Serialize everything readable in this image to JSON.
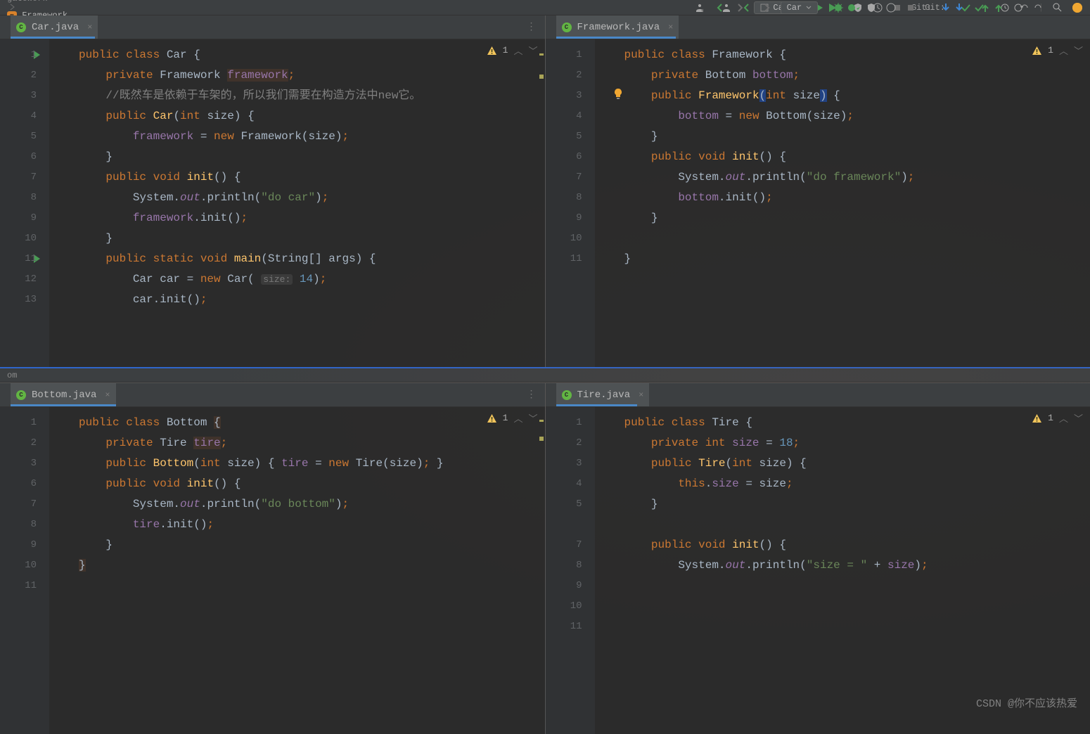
{
  "breadcrumb": {
    "seg1": "gatework",
    "seg2": "Framework"
  },
  "breadcrumb2": {
    "seg1": "om"
  },
  "runConfig": "Car",
  "gitLabel": "Git:",
  "watermark": "CSDN @你不应该热爱",
  "panes": {
    "car": {
      "tab": "Car.java",
      "warn": "1",
      "lines": [
        "1",
        "2",
        "3",
        "4",
        "5",
        "6",
        "7",
        "8",
        "9",
        "10",
        "11",
        "12",
        "13"
      ],
      "code": [
        [
          {
            "t": "public ",
            "c": "hl-kw"
          },
          {
            "t": "class ",
            "c": "hl-kw"
          },
          {
            "t": "Car {"
          }
        ],
        [
          {
            "t": "    "
          },
          {
            "t": "private ",
            "c": "hl-kw"
          },
          {
            "t": "Framework "
          },
          {
            "t": "framework",
            "c": "hl-field hl-usage"
          },
          {
            "t": ";",
            "c": "hl-kw"
          }
        ],
        [
          {
            "t": "    "
          },
          {
            "t": "//既然车是依赖于车架的，所以我们需要在构造方法中new它。",
            "c": "hl-comment"
          }
        ],
        [
          {
            "t": "    "
          },
          {
            "t": "public ",
            "c": "hl-kw"
          },
          {
            "t": "Car",
            "c": "hl-fn"
          },
          {
            "t": "("
          },
          {
            "t": "int ",
            "c": "hl-kw"
          },
          {
            "t": "size) {"
          }
        ],
        [
          {
            "t": "        "
          },
          {
            "t": "framework",
            "c": "hl-field"
          },
          {
            "t": " = "
          },
          {
            "t": "new ",
            "c": "hl-kw"
          },
          {
            "t": "Framework(size)"
          },
          {
            "t": ";",
            "c": "hl-kw"
          }
        ],
        [
          {
            "t": "    }"
          }
        ],
        [
          {
            "t": "    "
          },
          {
            "t": "public ",
            "c": "hl-kw"
          },
          {
            "t": "void ",
            "c": "hl-kw"
          },
          {
            "t": "init",
            "c": "hl-fn"
          },
          {
            "t": "() {"
          }
        ],
        [
          {
            "t": "        System."
          },
          {
            "t": "out",
            "c": "hl-static"
          },
          {
            "t": ".println("
          },
          {
            "t": "\"do car\"",
            "c": "hl-str"
          },
          {
            "t": ")"
          },
          {
            "t": ";",
            "c": "hl-kw"
          }
        ],
        [
          {
            "t": "        "
          },
          {
            "t": "framework",
            "c": "hl-field"
          },
          {
            "t": ".init()"
          },
          {
            "t": ";",
            "c": "hl-kw"
          }
        ],
        [
          {
            "t": "    }"
          }
        ],
        [
          {
            "t": "    "
          },
          {
            "t": "public ",
            "c": "hl-kw"
          },
          {
            "t": "static ",
            "c": "hl-kw"
          },
          {
            "t": "void ",
            "c": "hl-kw"
          },
          {
            "t": "main",
            "c": "hl-fn"
          },
          {
            "t": "(String[] args) {"
          }
        ],
        [
          {
            "t": "        Car car = "
          },
          {
            "t": "new ",
            "c": "hl-kw"
          },
          {
            "t": "Car( "
          },
          {
            "t": "size:",
            "c": "hl-hint"
          },
          {
            "t": " "
          },
          {
            "t": "14",
            "c": "hl-num"
          },
          {
            "t": ")"
          },
          {
            "t": ";",
            "c": "hl-kw"
          }
        ],
        [
          {
            "t": "        car.init()"
          },
          {
            "t": ";",
            "c": "hl-kw"
          }
        ]
      ]
    },
    "fw": {
      "tab": "Framework.java",
      "warn": "1",
      "lines": [
        "1",
        "2",
        "3",
        "4",
        "5",
        "6",
        "7",
        "8",
        "9",
        "10",
        "11"
      ],
      "code": [
        [
          {
            "t": "public ",
            "c": "hl-kw"
          },
          {
            "t": "class ",
            "c": "hl-kw"
          },
          {
            "t": "Framework {"
          }
        ],
        [
          {
            "t": "    "
          },
          {
            "t": "private ",
            "c": "hl-kw"
          },
          {
            "t": "Bottom "
          },
          {
            "t": "bottom",
            "c": "hl-field"
          },
          {
            "t": ";",
            "c": "hl-kw"
          }
        ],
        [
          {
            "t": "    "
          },
          {
            "t": "public ",
            "c": "hl-kw"
          },
          {
            "t": "Framework",
            "c": "hl-fn"
          },
          {
            "t": "(",
            "c": "hl-caret"
          },
          {
            "t": "int ",
            "c": "hl-kw"
          },
          {
            "t": "size"
          },
          {
            "t": ")",
            "c": "hl-caret"
          },
          {
            "t": " {"
          }
        ],
        [
          {
            "t": "        "
          },
          {
            "t": "bottom",
            "c": "hl-field"
          },
          {
            "t": " = "
          },
          {
            "t": "new ",
            "c": "hl-kw"
          },
          {
            "t": "Bottom(size)"
          },
          {
            "t": ";",
            "c": "hl-kw"
          }
        ],
        [
          {
            "t": "    }"
          }
        ],
        [
          {
            "t": "    "
          },
          {
            "t": "public ",
            "c": "hl-kw"
          },
          {
            "t": "void ",
            "c": "hl-kw"
          },
          {
            "t": "init",
            "c": "hl-fn"
          },
          {
            "t": "() {"
          }
        ],
        [
          {
            "t": "        System."
          },
          {
            "t": "out",
            "c": "hl-static"
          },
          {
            "t": ".println("
          },
          {
            "t": "\"do framework\"",
            "c": "hl-str"
          },
          {
            "t": ")"
          },
          {
            "t": ";",
            "c": "hl-kw"
          }
        ],
        [
          {
            "t": "        "
          },
          {
            "t": "bottom",
            "c": "hl-field"
          },
          {
            "t": ".init()"
          },
          {
            "t": ";",
            "c": "hl-kw"
          }
        ],
        [
          {
            "t": "    }"
          }
        ],
        [
          {
            "t": ""
          }
        ],
        [
          {
            "t": "}"
          }
        ]
      ]
    },
    "bottom": {
      "tab": "Bottom.java",
      "warn": "1",
      "lines": [
        "1",
        "2",
        "3",
        "6",
        "7",
        "8",
        "9",
        "10",
        "11"
      ],
      "code": [
        [
          {
            "t": "public ",
            "c": "hl-kw"
          },
          {
            "t": "class ",
            "c": "hl-kw"
          },
          {
            "t": "Bottom "
          },
          {
            "t": "{",
            "c": "hl-usage"
          }
        ],
        [
          {
            "t": "    "
          },
          {
            "t": "private ",
            "c": "hl-kw"
          },
          {
            "t": "Tire "
          },
          {
            "t": "tire",
            "c": "hl-field hl-usage"
          },
          {
            "t": ";",
            "c": "hl-kw"
          }
        ],
        [
          {
            "t": "    "
          },
          {
            "t": "public ",
            "c": "hl-kw"
          },
          {
            "t": "Bottom",
            "c": "hl-fn"
          },
          {
            "t": "("
          },
          {
            "t": "int ",
            "c": "hl-kw"
          },
          {
            "t": "size) { "
          },
          {
            "t": "tire",
            "c": "hl-field"
          },
          {
            "t": " = "
          },
          {
            "t": "new ",
            "c": "hl-kw"
          },
          {
            "t": "Tire(size)"
          },
          {
            "t": ";",
            "c": "hl-kw"
          },
          {
            "t": " }"
          }
        ],
        [
          {
            "t": "    "
          },
          {
            "t": "public ",
            "c": "hl-kw"
          },
          {
            "t": "void ",
            "c": "hl-kw"
          },
          {
            "t": "init",
            "c": "hl-fn"
          },
          {
            "t": "() {"
          }
        ],
        [
          {
            "t": "        System."
          },
          {
            "t": "out",
            "c": "hl-static"
          },
          {
            "t": ".println("
          },
          {
            "t": "\"do bottom\"",
            "c": "hl-str"
          },
          {
            "t": ")"
          },
          {
            "t": ";",
            "c": "hl-kw"
          }
        ],
        [
          {
            "t": "        "
          },
          {
            "t": "tire",
            "c": "hl-field"
          },
          {
            "t": ".init()"
          },
          {
            "t": ";",
            "c": "hl-kw"
          }
        ],
        [
          {
            "t": "    }"
          }
        ],
        [
          {
            "t": "}",
            "c": "hl-usage"
          }
        ],
        [
          {
            "t": ""
          }
        ]
      ]
    },
    "tire": {
      "tab": "Tire.java",
      "warn": "1",
      "lines": [
        "1",
        "2",
        "3",
        "4",
        "5",
        "",
        "7",
        "8",
        "9",
        "10",
        "11"
      ],
      "code": [
        [
          {
            "t": "public ",
            "c": "hl-kw"
          },
          {
            "t": "class ",
            "c": "hl-kw"
          },
          {
            "t": "Tire {"
          }
        ],
        [
          {
            "t": "    "
          },
          {
            "t": "private ",
            "c": "hl-kw"
          },
          {
            "t": "int ",
            "c": "hl-kw"
          },
          {
            "t": "size",
            "c": "hl-field"
          },
          {
            "t": " = "
          },
          {
            "t": "18",
            "c": "hl-num"
          },
          {
            "t": ";",
            "c": "hl-kw"
          }
        ],
        [
          {
            "t": "    "
          },
          {
            "t": "public ",
            "c": "hl-kw"
          },
          {
            "t": "Tire",
            "c": "hl-fn"
          },
          {
            "t": "("
          },
          {
            "t": "int ",
            "c": "hl-kw"
          },
          {
            "t": "size) {"
          }
        ],
        [
          {
            "t": "        "
          },
          {
            "t": "this",
            "c": "hl-kw"
          },
          {
            "t": "."
          },
          {
            "t": "size",
            "c": "hl-field"
          },
          {
            "t": " = size"
          },
          {
            "t": ";",
            "c": "hl-kw"
          }
        ],
        [
          {
            "t": "    }"
          }
        ],
        [
          {
            "t": ""
          }
        ],
        [
          {
            "t": "    "
          },
          {
            "t": "public ",
            "c": "hl-kw"
          },
          {
            "t": "void ",
            "c": "hl-kw"
          },
          {
            "t": "init",
            "c": "hl-fn"
          },
          {
            "t": "() {"
          }
        ],
        [
          {
            "t": "        System."
          },
          {
            "t": "out",
            "c": "hl-static"
          },
          {
            "t": ".println("
          },
          {
            "t": "\"size = \" ",
            "c": "hl-str"
          },
          {
            "t": "+ "
          },
          {
            "t": "size",
            "c": "hl-field"
          },
          {
            "t": ")"
          },
          {
            "t": ";",
            "c": "hl-kw"
          }
        ],
        [
          {
            "t": ""
          }
        ],
        [
          {
            "t": ""
          }
        ],
        [
          {
            "t": ""
          }
        ]
      ]
    }
  }
}
